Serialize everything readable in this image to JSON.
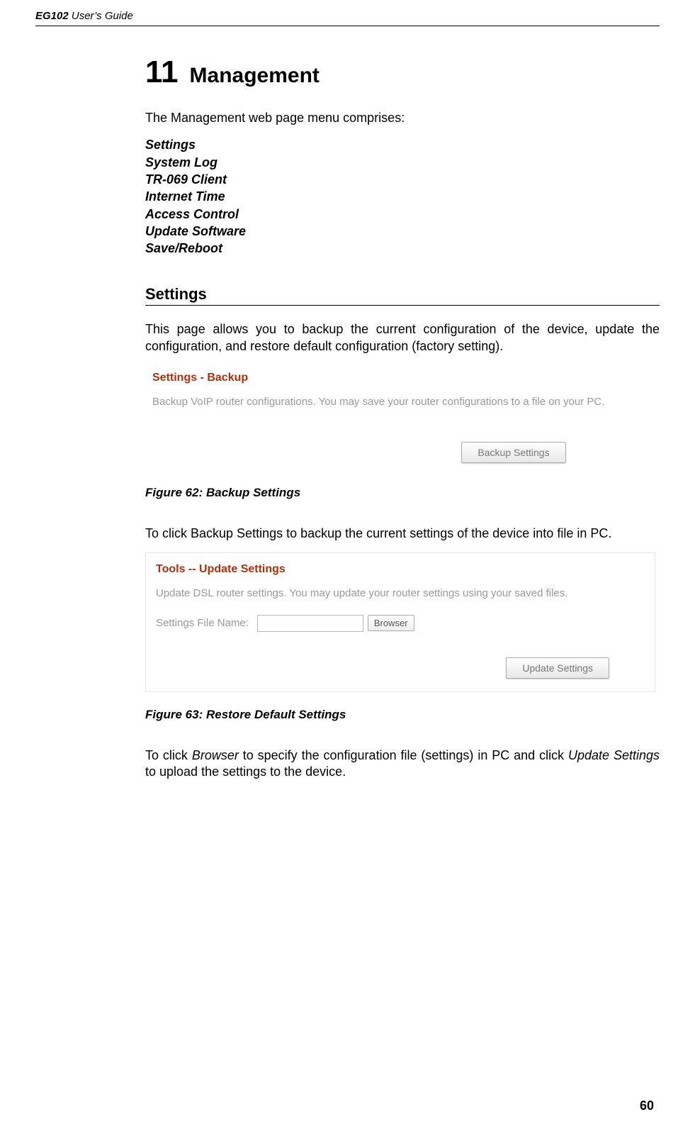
{
  "header": {
    "bold_prefix": "EG102",
    "suffix": " User’s Guide"
  },
  "chapter": {
    "number": "11",
    "title": "Management"
  },
  "intro": "The Management web page menu comprises:",
  "menu": [
    "Settings",
    "System Log",
    "TR-069 Client",
    "Internet Time",
    "Access Control",
    "Update Software",
    "Save/Reboot"
  ],
  "section_settings": {
    "heading": "Settings",
    "p1": "This page allows you to backup the current configuration of the device, update the configuration, and restore default configuration (factory setting)."
  },
  "backup_ss": {
    "title": "Settings - Backup",
    "desc": "Backup VoIP router configurations. You may save your router configurations to a file on your PC.",
    "button": "Backup Settings"
  },
  "fig62": "Figure 62: Backup Settings",
  "p_after_fig62": "To click Backup Settings to backup the current settings of the device into file in PC.",
  "update_ss": {
    "title": "Tools -- Update Settings",
    "desc": "Update DSL router settings. You may update your router settings using your saved files.",
    "field_label": "Settings File Name:",
    "browse": "Browser",
    "button": "Update Settings"
  },
  "fig63": "Figure 63: Restore Default Settings",
  "p_after_fig63_pre": "To click ",
  "p_after_fig63_i1": "Browser",
  "p_after_fig63_mid": " to specify the configuration file (settings) in PC and click ",
  "p_after_fig63_i2": "Update Settings",
  "p_after_fig63_post": " to upload the settings to the device.",
  "page_number": "60"
}
